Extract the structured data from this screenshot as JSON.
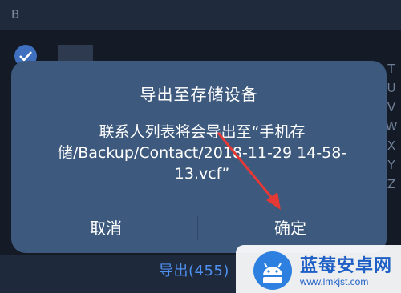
{
  "background": {
    "section_letter": "B",
    "index_letters": [
      "T",
      "U",
      "V",
      "W",
      "X",
      "Y",
      "Z"
    ],
    "bottom_action": "导出(455)"
  },
  "dialog": {
    "title": "导出至存储设备",
    "message": "联系人列表将会导出至“手机存储/Backup/Contact/2018-11-29 14-58-13.vcf”",
    "cancel_label": "取消",
    "confirm_label": "确定"
  },
  "watermark": {
    "title": "蓝莓安卓网",
    "url": "www.lmkjst.com"
  },
  "colors": {
    "dialog_bg": "#3d5a7e",
    "accent": "#4f8ff0",
    "arrow": "#e53935",
    "check": "#3f6fbf"
  },
  "icons": {
    "row_check": "checkmark-circle-icon",
    "watermark_logo": "android-robot-icon",
    "annotation": "red-arrow-icon"
  }
}
